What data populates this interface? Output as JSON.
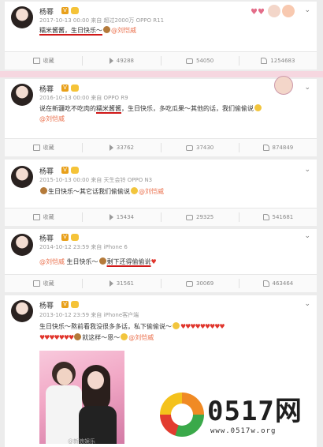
{
  "posts": [
    {
      "username": "杨幂",
      "meta": "2017-10-13 00:00 来自 超过2000万 OPPO R11",
      "line1": "糯米酱酱，生日快乐～",
      "mention": "@刘恺威",
      "actions": [
        "收藏",
        "49288",
        "54050",
        "1254683"
      ]
    },
    {
      "username": "杨幂",
      "meta": "2016-10-13 00:00 来自 OPPO R9",
      "line1_prefix": "说在新疆吃不吃肉的",
      "line1_underlined": "糯米酱酱",
      "line1_suffix": "，生日快乐，多吃瓜果～其他的话，我们偷偷说",
      "mention": "@刘恺威",
      "actions": [
        "收藏",
        "33762",
        "37430",
        "874849"
      ]
    },
    {
      "username": "杨幂",
      "meta": "2015-10-13 00:00 来自 天生会铃 OPPO N3",
      "line1": "生日快乐～其它话我们偷偷说",
      "mention": "@刘恺威",
      "actions": [
        "收藏",
        "15434",
        "29325",
        "541681"
      ]
    },
    {
      "username": "杨幂",
      "meta": "2014-10-12 23:59 来自 iPhone 6",
      "mention": "@刘恺威",
      "line1": "生日快乐～",
      "line1_suffix": "剩下还得偷偷说",
      "actions": [
        "收藏",
        "31561",
        "30069",
        "463464"
      ]
    },
    {
      "username": "杨幂",
      "meta": "2013-10-12 23:59 来自 iPhone客户端",
      "line1": "生日快乐～熬前看我没很多多话，私下偷偷说～",
      "line2": "就这样～恩～",
      "mention": "@刘恺威",
      "photo_watermark": "@新浪娱乐"
    }
  ],
  "logo": {
    "text": "0517网",
    "url": "www.0517w.org"
  },
  "colors": {
    "accent_orange": "#eb7350",
    "underline_red": "#d01818",
    "heart_red": "#e0342b",
    "pink_divider": "#f6d7e0"
  }
}
